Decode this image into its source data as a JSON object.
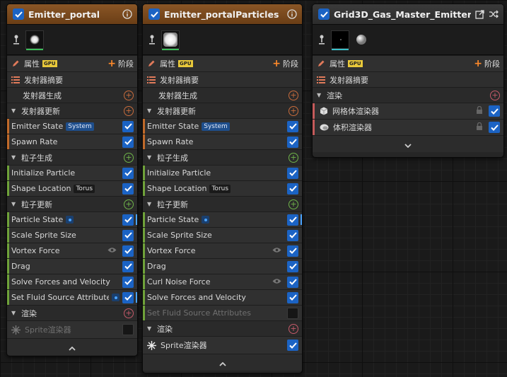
{
  "node1": {
    "title": "Emitter_portal",
    "props_label": "属性",
    "gpu": "GPU",
    "stage_label": "阶段",
    "summary_label": "发射器摘要",
    "emitter_spawn": "发射器生成",
    "emitter_update": "发射器更新",
    "emitter_state": "Emitter State",
    "emitter_state_tag": "System",
    "spawn_rate": "Spawn Rate",
    "particle_spawn": "粒子生成",
    "initialize_particle": "Initialize Particle",
    "shape_location": "Shape Location",
    "shape_location_tag": "Torus",
    "particle_update": "粒子更新",
    "particle_state": "Particle State",
    "scale_sprite_size": "Scale Sprite Size",
    "vortex_force": "Vortex Force",
    "drag": "Drag",
    "solve_forces": "Solve Forces and Velocity",
    "set_fluid": "Set Fluid Source Attributes",
    "render": "渲染",
    "sprite_renderer": "Sprite渲染器"
  },
  "node2": {
    "title": "Emitter_portalParticles",
    "props_label": "属性",
    "gpu": "GPU",
    "stage_label": "阶段",
    "summary_label": "发射器摘要",
    "emitter_spawn": "发射器生成",
    "emitter_update": "发射器更新",
    "emitter_state": "Emitter State",
    "emitter_state_tag": "System",
    "spawn_rate": "Spawn Rate",
    "particle_spawn": "粒子生成",
    "initialize_particle": "Initialize Particle",
    "shape_location": "Shape Location",
    "shape_location_tag": "Torus",
    "particle_update": "粒子更新",
    "particle_state": "Particle State",
    "scale_sprite_size": "Scale Sprite Size",
    "vortex_force": "Vortex Force",
    "drag": "Drag",
    "curl_noise": "Curl Noise Force",
    "solve_forces": "Solve Forces and Velocity",
    "set_fluid": "Set Fluid Source Attributes",
    "render": "渲染",
    "sprite_renderer": "Sprite渲染器"
  },
  "node3": {
    "title": "Grid3D_Gas_Master_Emitter",
    "props_label": "属性",
    "gpu": "GPU",
    "stage_label": "阶段",
    "summary_label": "发射器摘要",
    "render": "渲染",
    "mesh_renderer": "网格体渲染器",
    "volume_renderer": "体积渲染器"
  }
}
